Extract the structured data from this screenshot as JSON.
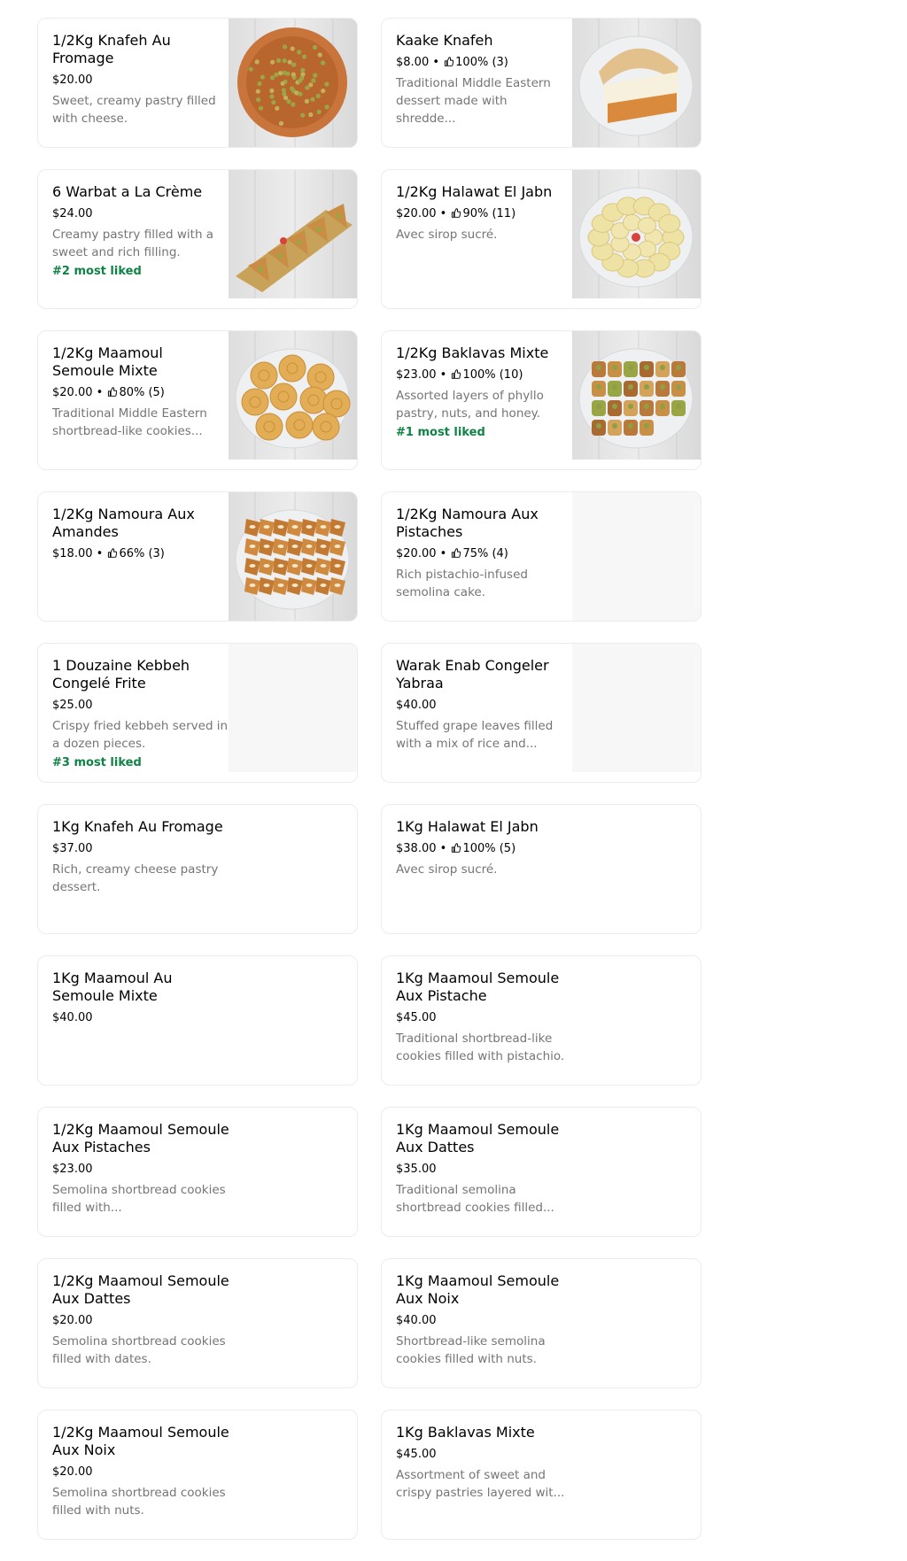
{
  "items": [
    {
      "name": "1/2Kg Knafeh Au Fromage",
      "price": "$20.00",
      "rating": "",
      "description": "Sweet, creamy pastry filled with cheese.",
      "badge": "",
      "has_image": true,
      "image": "knafeh-round"
    },
    {
      "name": "Kaake Knafeh",
      "price": "$8.00",
      "rating": "100% (3)",
      "description": "Traditional Middle Eastern dessert made with shredde...",
      "badge": "",
      "has_image": true,
      "image": "kaake"
    },
    {
      "name": "6 Warbat a La Crème",
      "price": "$24.00",
      "rating": "",
      "description": "Creamy pastry filled with a sweet and rich filling.",
      "badge": "#2 most liked",
      "has_image": true,
      "image": "warbat"
    },
    {
      "name": "1/2Kg Halawat El Jabn",
      "price": "$20.00",
      "rating": "90% (11)",
      "description": "Avec sirop sucré.",
      "badge": "",
      "has_image": true,
      "image": "halawat"
    },
    {
      "name": "1/2Kg Maamoul Semoule Mixte",
      "price": "$20.00",
      "rating": "80% (5)",
      "description": "Traditional Middle Eastern shortbread-like cookies...",
      "badge": "",
      "has_image": true,
      "image": "maamoul"
    },
    {
      "name": "1/2Kg Baklavas Mixte",
      "price": "$23.00",
      "rating": "100% (10)",
      "description": "Assorted layers of phyllo pastry, nuts, and honey.",
      "badge": "#1 most liked",
      "has_image": true,
      "image": "baklava"
    },
    {
      "name": "1/2Kg Namoura Aux Amandes",
      "price": "$18.00",
      "rating": "66% (3)",
      "description": "",
      "badge": "",
      "has_image": true,
      "image": "namoura"
    },
    {
      "name": "1/2Kg Namoura Aux Pistaches",
      "price": "$20.00",
      "rating": "75% (4)",
      "description": "Rich pistachio-infused semolina cake.",
      "badge": "",
      "has_image": false,
      "image": ""
    },
    {
      "name": "1 Douzaine Kebbeh Congelé Frite",
      "price": "$25.00",
      "rating": "",
      "description": "Crispy fried kebbeh served in a dozen pieces.",
      "badge": "#3 most liked",
      "has_image": false,
      "image": ""
    },
    {
      "name": "Warak Enab Congeler Yabraa",
      "price": "$40.00",
      "rating": "",
      "description": "Stuffed grape leaves filled with a mix of rice and...",
      "badge": "",
      "has_image": false,
      "image": ""
    },
    {
      "name": "1Kg Knafeh Au Fromage",
      "price": "$37.00",
      "rating": "",
      "description": "Rich, creamy cheese pastry dessert.",
      "badge": "",
      "has_image": false,
      "image": ""
    },
    {
      "name": "1Kg Halawat El Jabn",
      "price": "$38.00",
      "rating": "100% (5)",
      "description": "Avec sirop sucré.",
      "badge": "",
      "has_image": false,
      "image": ""
    },
    {
      "name": "1Kg Maamoul Au Semoule Mixte",
      "price": "$40.00",
      "rating": "",
      "description": "",
      "badge": "",
      "has_image": false,
      "image": ""
    },
    {
      "name": "1Kg Maamoul Semoule Aux Pistache",
      "price": "$45.00",
      "rating": "",
      "description": "Traditional shortbread-like cookies filled with pistachio.",
      "badge": "",
      "has_image": false,
      "image": ""
    },
    {
      "name": "1/2Kg Maamoul Semoule Aux Pistaches",
      "price": "$23.00",
      "rating": "",
      "description": "Semolina shortbread cookies filled with...",
      "badge": "",
      "has_image": false,
      "image": ""
    },
    {
      "name": "1Kg Maamoul Semoule Aux Dattes",
      "price": "$35.00",
      "rating": "",
      "description": "Traditional semolina shortbread cookies filled...",
      "badge": "",
      "has_image": false,
      "image": ""
    },
    {
      "name": "1/2Kg Maamoul Semoule Aux Dattes",
      "price": "$20.00",
      "rating": "",
      "description": "Semolina shortbread cookies filled with dates.",
      "badge": "",
      "has_image": false,
      "image": ""
    },
    {
      "name": "1Kg Maamoul Semoule Aux Noix",
      "price": "$40.00",
      "rating": "",
      "description": "Shortbread-like semolina cookies filled with nuts.",
      "badge": "",
      "has_image": false,
      "image": ""
    },
    {
      "name": "1/2Kg Maamoul Semoule Aux Noix",
      "price": "$20.00",
      "rating": "",
      "description": "Semolina shortbread cookies filled with nuts.",
      "badge": "",
      "has_image": false,
      "image": ""
    },
    {
      "name": "1Kg Baklavas Mixte",
      "price": "$45.00",
      "rating": "",
      "description": "Assortment of sweet and crispy pastries layered wit...",
      "badge": "",
      "has_image": false,
      "image": ""
    }
  ],
  "rating_icon": "thumbs-up-icon",
  "colors": {
    "badge": "#0e8345",
    "description": "#757575",
    "border": "#ececec",
    "placeholder": "#f7f7f7"
  }
}
